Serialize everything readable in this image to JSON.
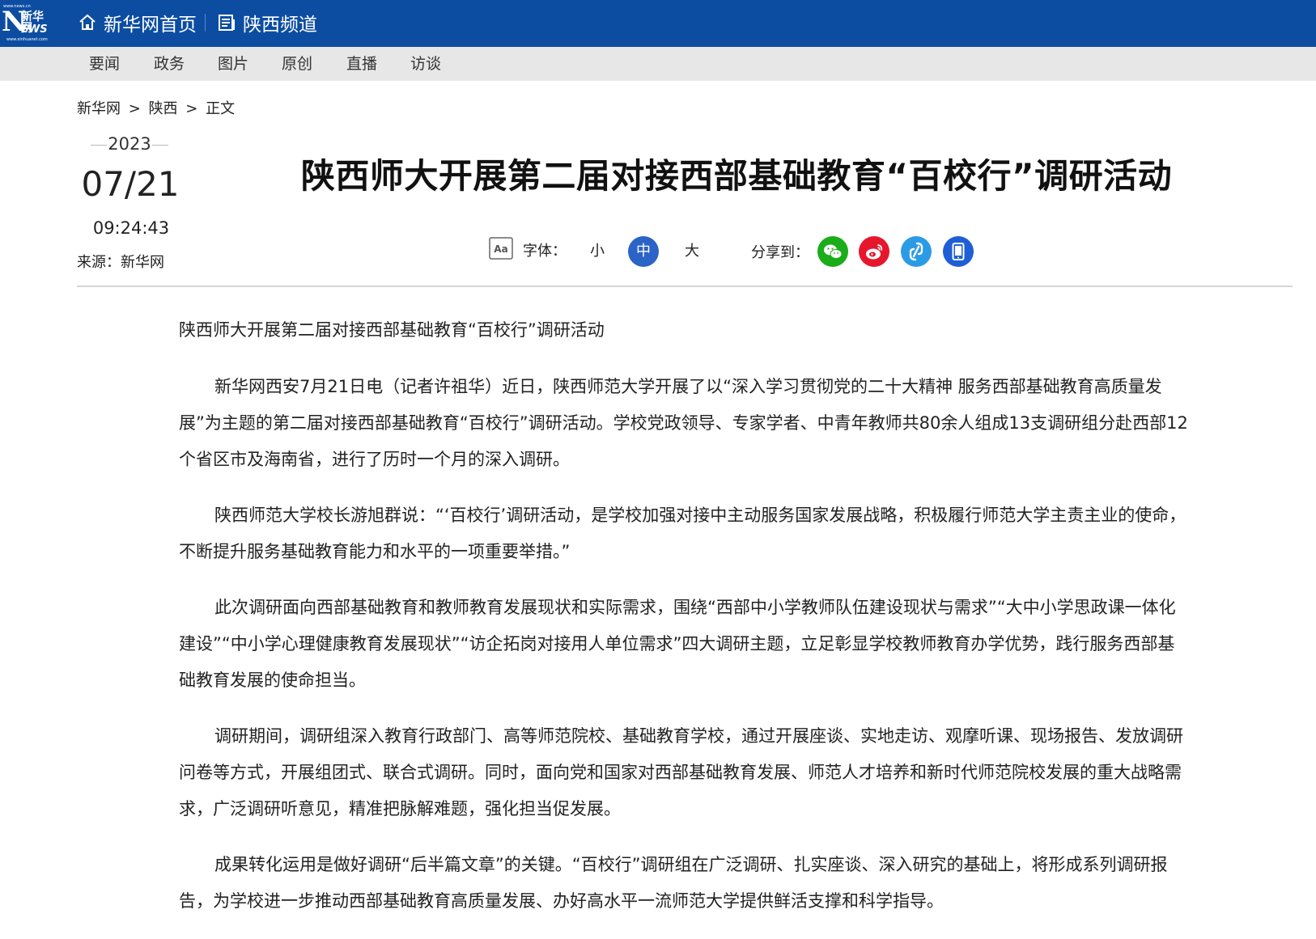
{
  "header": {
    "logo": {
      "top_small": "www.news.cn",
      "mark": "N",
      "cn": "新华网",
      "ws": "EWS",
      "bottom_small": "www.xinhuanet.com"
    },
    "home_label": "新华网首页",
    "channel_label": "陕西频道"
  },
  "subnav": {
    "items": [
      {
        "label": "要闻"
      },
      {
        "label": "政务"
      },
      {
        "label": "图片"
      },
      {
        "label": "原创"
      },
      {
        "label": "直播"
      },
      {
        "label": "访谈"
      }
    ]
  },
  "breadcrumb": {
    "items": [
      "新华网",
      "陕西",
      "正文"
    ],
    "sep": ">"
  },
  "meta": {
    "year": "2023",
    "month_day": "07/21",
    "time": "09:24:43",
    "source": "来源：新华网"
  },
  "article": {
    "title": "陕西师大开展第二届对接西部基础教育“百校行”调研活动",
    "lead": "陕西师大开展第二届对接西部基础教育“百校行”调研活动",
    "paragraphs": [
      "新华网西安7月21日电（记者许祖华）近日，陕西师范大学开展了以“深入学习贯彻党的二十大精神 服务西部基础教育高质量发展”为主题的第二届对接西部基础教育“百校行”调研活动。学校党政领导、专家学者、中青年教师共80余人组成13支调研组分赴西部12个省区市及海南省，进行了历时一个月的深入调研。",
      "陕西师范大学校长游旭群说：“‘百校行’调研活动，是学校加强对接中主动服务国家发展战略，积极履行师范大学主责主业的使命，不断提升服务基础教育能力和水平的一项重要举措。”",
      "此次调研面向西部基础教育和教师教育发展现状和实际需求，围绕“西部中小学教师队伍建设现状与需求”“大中小学思政课一体化建设”“中小学心理健康教育发展现状”“访企拓岗对接用人单位需求”四大调研主题，立足彰显学校教师教育办学优势，践行服务西部基础教育发展的使命担当。",
      "调研期间，调研组深入教育行政部门、高等师范院校、基础教育学校，通过开展座谈、实地走访、观摩听课、现场报告、发放调研问卷等方式，开展组团式、联合式调研。同时，面向党和国家对西部基础教育发展、师范人才培养和新时代师范院校发展的重大战略需求，广泛调研听意见，精准把脉解难题，强化担当促发展。",
      "成果转化运用是做好调研“后半篇文章”的关键。“百校行”调研组在广泛调研、扎实座谈、深入研究的基础上，将形成系列调研报告，为学校进一步推动西部基础教育高质量发展、办好高水平一流师范大学提供鲜活支撑和科学指导。"
    ]
  },
  "toolbar": {
    "font_icon_text": "Aa",
    "font_label": "字体：",
    "small": "小",
    "medium": "中",
    "large": "大",
    "share_label": "分享到：",
    "share_icons": [
      "wechat-icon",
      "weibo-icon",
      "link-icon",
      "mobile-icon"
    ]
  },
  "colors": {
    "header_blue": "#0c4da2",
    "subnav_gray": "#e7e7e7",
    "active_font_blue": "#2b63c6",
    "wechat_green": "#1aad19",
    "weibo_red": "#e6162d",
    "link_blue": "#2c9be6",
    "mobile_blue": "#1f5fd6"
  }
}
